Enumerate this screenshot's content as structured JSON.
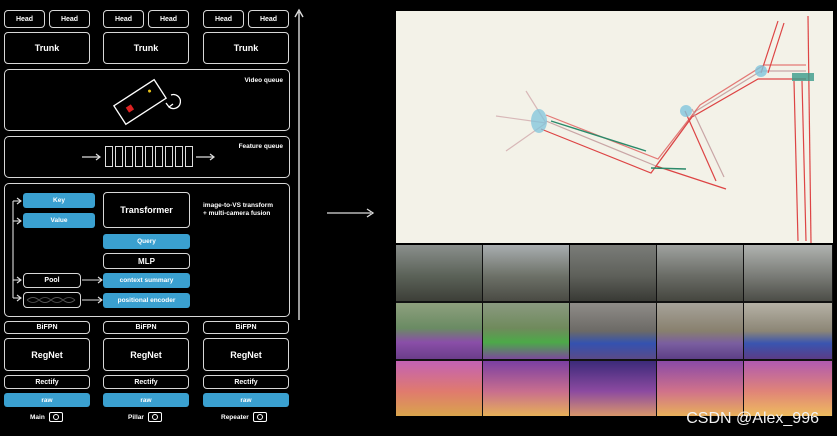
{
  "heads": {
    "label": "Head"
  },
  "trunk": {
    "label": "Trunk"
  },
  "video_queue": {
    "label": "Video queue"
  },
  "feature_queue": {
    "label": "Feature queue"
  },
  "fusion": {
    "key": "Key",
    "value": "Value",
    "transformer": "Transformer",
    "desc_line1": "image-to-VS transform",
    "desc_line2": "+ multi-camera fusion",
    "query": "Query",
    "mlp": "MLP",
    "pool": "Pool",
    "context_summary": "context summary",
    "positional_encoder": "positional encoder"
  },
  "backbone": {
    "bifpn": "BiFPN",
    "regnet": "RegNet",
    "rectify": "Rectify",
    "raw": "raw"
  },
  "cameras": [
    "Main",
    "Pillar",
    "Repeater"
  ],
  "watermark": "CSDN @Alex_996",
  "colors": {
    "accent_blue": "#3aa0d0",
    "background": "#000000",
    "map_background": "#f3f2e8"
  }
}
